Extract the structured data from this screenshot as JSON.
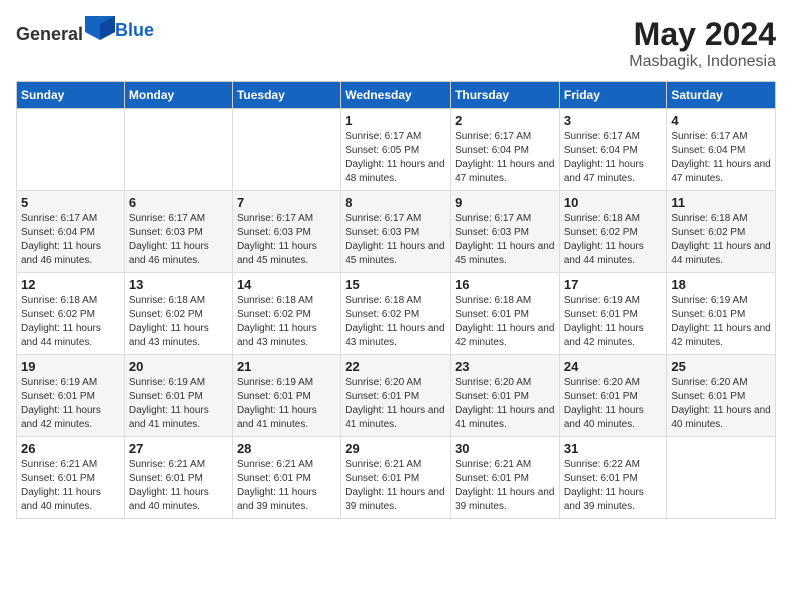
{
  "header": {
    "logo_general": "General",
    "logo_blue": "Blue",
    "month_year": "May 2024",
    "location": "Masbagik, Indonesia"
  },
  "days_of_week": [
    "Sunday",
    "Monday",
    "Tuesday",
    "Wednesday",
    "Thursday",
    "Friday",
    "Saturday"
  ],
  "weeks": [
    [
      {
        "num": "",
        "sunrise": "",
        "sunset": "",
        "daylight": ""
      },
      {
        "num": "",
        "sunrise": "",
        "sunset": "",
        "daylight": ""
      },
      {
        "num": "",
        "sunrise": "",
        "sunset": "",
        "daylight": ""
      },
      {
        "num": "1",
        "sunrise": "6:17 AM",
        "sunset": "6:05 PM",
        "daylight": "11 hours and 48 minutes."
      },
      {
        "num": "2",
        "sunrise": "6:17 AM",
        "sunset": "6:04 PM",
        "daylight": "11 hours and 47 minutes."
      },
      {
        "num": "3",
        "sunrise": "6:17 AM",
        "sunset": "6:04 PM",
        "daylight": "11 hours and 47 minutes."
      },
      {
        "num": "4",
        "sunrise": "6:17 AM",
        "sunset": "6:04 PM",
        "daylight": "11 hours and 47 minutes."
      }
    ],
    [
      {
        "num": "5",
        "sunrise": "6:17 AM",
        "sunset": "6:04 PM",
        "daylight": "11 hours and 46 minutes."
      },
      {
        "num": "6",
        "sunrise": "6:17 AM",
        "sunset": "6:03 PM",
        "daylight": "11 hours and 46 minutes."
      },
      {
        "num": "7",
        "sunrise": "6:17 AM",
        "sunset": "6:03 PM",
        "daylight": "11 hours and 45 minutes."
      },
      {
        "num": "8",
        "sunrise": "6:17 AM",
        "sunset": "6:03 PM",
        "daylight": "11 hours and 45 minutes."
      },
      {
        "num": "9",
        "sunrise": "6:17 AM",
        "sunset": "6:03 PM",
        "daylight": "11 hours and 45 minutes."
      },
      {
        "num": "10",
        "sunrise": "6:18 AM",
        "sunset": "6:02 PM",
        "daylight": "11 hours and 44 minutes."
      },
      {
        "num": "11",
        "sunrise": "6:18 AM",
        "sunset": "6:02 PM",
        "daylight": "11 hours and 44 minutes."
      }
    ],
    [
      {
        "num": "12",
        "sunrise": "6:18 AM",
        "sunset": "6:02 PM",
        "daylight": "11 hours and 44 minutes."
      },
      {
        "num": "13",
        "sunrise": "6:18 AM",
        "sunset": "6:02 PM",
        "daylight": "11 hours and 43 minutes."
      },
      {
        "num": "14",
        "sunrise": "6:18 AM",
        "sunset": "6:02 PM",
        "daylight": "11 hours and 43 minutes."
      },
      {
        "num": "15",
        "sunrise": "6:18 AM",
        "sunset": "6:02 PM",
        "daylight": "11 hours and 43 minutes."
      },
      {
        "num": "16",
        "sunrise": "6:18 AM",
        "sunset": "6:01 PM",
        "daylight": "11 hours and 42 minutes."
      },
      {
        "num": "17",
        "sunrise": "6:19 AM",
        "sunset": "6:01 PM",
        "daylight": "11 hours and 42 minutes."
      },
      {
        "num": "18",
        "sunrise": "6:19 AM",
        "sunset": "6:01 PM",
        "daylight": "11 hours and 42 minutes."
      }
    ],
    [
      {
        "num": "19",
        "sunrise": "6:19 AM",
        "sunset": "6:01 PM",
        "daylight": "11 hours and 42 minutes."
      },
      {
        "num": "20",
        "sunrise": "6:19 AM",
        "sunset": "6:01 PM",
        "daylight": "11 hours and 41 minutes."
      },
      {
        "num": "21",
        "sunrise": "6:19 AM",
        "sunset": "6:01 PM",
        "daylight": "11 hours and 41 minutes."
      },
      {
        "num": "22",
        "sunrise": "6:20 AM",
        "sunset": "6:01 PM",
        "daylight": "11 hours and 41 minutes."
      },
      {
        "num": "23",
        "sunrise": "6:20 AM",
        "sunset": "6:01 PM",
        "daylight": "11 hours and 41 minutes."
      },
      {
        "num": "24",
        "sunrise": "6:20 AM",
        "sunset": "6:01 PM",
        "daylight": "11 hours and 40 minutes."
      },
      {
        "num": "25",
        "sunrise": "6:20 AM",
        "sunset": "6:01 PM",
        "daylight": "11 hours and 40 minutes."
      }
    ],
    [
      {
        "num": "26",
        "sunrise": "6:21 AM",
        "sunset": "6:01 PM",
        "daylight": "11 hours and 40 minutes."
      },
      {
        "num": "27",
        "sunrise": "6:21 AM",
        "sunset": "6:01 PM",
        "daylight": "11 hours and 40 minutes."
      },
      {
        "num": "28",
        "sunrise": "6:21 AM",
        "sunset": "6:01 PM",
        "daylight": "11 hours and 39 minutes."
      },
      {
        "num": "29",
        "sunrise": "6:21 AM",
        "sunset": "6:01 PM",
        "daylight": "11 hours and 39 minutes."
      },
      {
        "num": "30",
        "sunrise": "6:21 AM",
        "sunset": "6:01 PM",
        "daylight": "11 hours and 39 minutes."
      },
      {
        "num": "31",
        "sunrise": "6:22 AM",
        "sunset": "6:01 PM",
        "daylight": "11 hours and 39 minutes."
      },
      {
        "num": "",
        "sunrise": "",
        "sunset": "",
        "daylight": ""
      }
    ]
  ],
  "labels": {
    "sunrise_prefix": "Sunrise: ",
    "sunset_prefix": "Sunset: ",
    "daylight_prefix": "Daylight: "
  }
}
